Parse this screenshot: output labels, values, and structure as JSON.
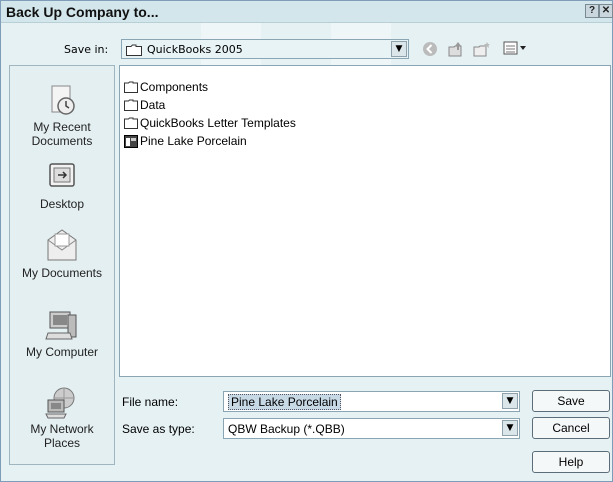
{
  "window": {
    "title": "Back Up Company to...",
    "help_btn": "?",
    "close_btn": "✕"
  },
  "toolbar": {
    "save_in_label": "Save in:",
    "save_in_value": "QuickBooks 2005",
    "icons": [
      "back-icon",
      "up-folder-icon",
      "new-folder-icon",
      "views-menu-icon"
    ]
  },
  "places": [
    {
      "label1": "My Recent",
      "label2": "Documents",
      "icon": "my-recent-documents-icon"
    },
    {
      "label1": "Desktop",
      "label2": "",
      "icon": "desktop-icon"
    },
    {
      "label1": "My Documents",
      "label2": "",
      "icon": "my-documents-icon"
    },
    {
      "label1": "My Computer",
      "label2": "",
      "icon": "my-computer-icon"
    },
    {
      "label1": "My Network",
      "label2": "Places",
      "icon": "my-network-places-icon"
    }
  ],
  "files": [
    {
      "name": "Components",
      "type": "folder"
    },
    {
      "name": "Data",
      "type": "folder"
    },
    {
      "name": "QuickBooks Letter Templates",
      "type": "folder"
    },
    {
      "name": "Pine Lake Porcelain",
      "type": "qbb"
    }
  ],
  "form": {
    "file_name_label": "File name:",
    "file_name_value": "Pine Lake Porcelain",
    "save_as_type_label": "Save as type:",
    "save_as_type_value": "QBW Backup (*.QBB)"
  },
  "buttons": {
    "save": "Save",
    "cancel": "Cancel",
    "help": "Help"
  },
  "colors": {
    "dialog_bg": "#e6f1f4",
    "titlebar_bg": "#d2e6ec",
    "selection": "#c8d9e6"
  }
}
